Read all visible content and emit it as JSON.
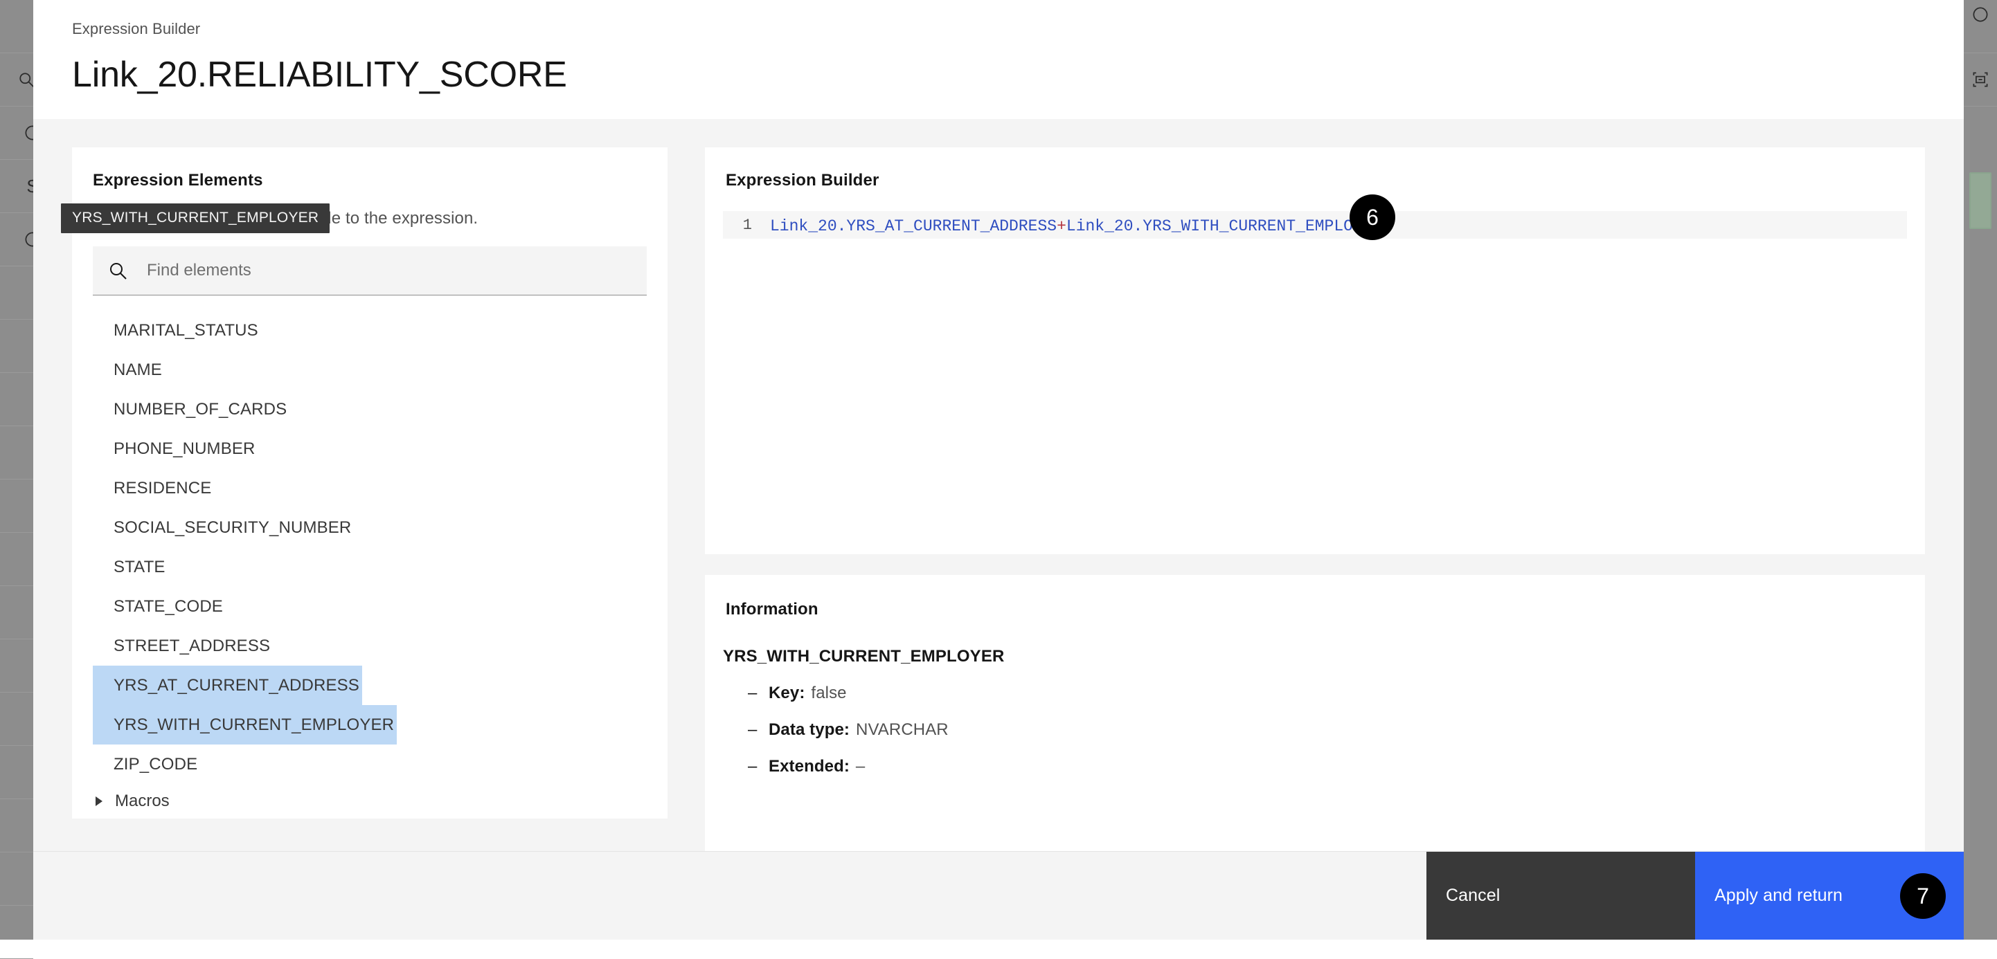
{
  "window": {
    "left_rail_icons": [
      "search-icon",
      "circle-icon",
      "s-icon",
      "circle-icon-2"
    ],
    "right_rail_icons": [
      "circle-icon",
      "component-icon"
    ]
  },
  "modal": {
    "eyebrow": "Expression Builder",
    "title": "Link_20.RELIABILITY_SCORE"
  },
  "tooltip": {
    "text": "YRS_WITH_CURRENT_EMPLOYER"
  },
  "left_panel": {
    "heading": "Expression Elements",
    "description": "Select an element to add its code to the expression.",
    "search": {
      "placeholder": "Find elements",
      "value": "",
      "icon": "search-icon"
    },
    "elements": [
      {
        "label": "MARITAL_STATUS",
        "selected": false
      },
      {
        "label": "NAME",
        "selected": false
      },
      {
        "label": "NUMBER_OF_CARDS",
        "selected": false
      },
      {
        "label": "PHONE_NUMBER",
        "selected": false
      },
      {
        "label": "RESIDENCE",
        "selected": false
      },
      {
        "label": "SOCIAL_SECURITY_NUMBER",
        "selected": false
      },
      {
        "label": "STATE",
        "selected": false
      },
      {
        "label": "STATE_CODE",
        "selected": false
      },
      {
        "label": "STREET_ADDRESS",
        "selected": false
      },
      {
        "label": "YRS_AT_CURRENT_ADDRESS",
        "selected": true
      },
      {
        "label": "YRS_WITH_CURRENT_EMPLOYER",
        "selected": true
      },
      {
        "label": "ZIP_CODE",
        "selected": false
      }
    ],
    "macros": {
      "label": "Macros",
      "expanded": false,
      "icon": "triangle-right-icon"
    },
    "selection_color": "#bcd8f5"
  },
  "expression_panel": {
    "heading": "Expression Builder",
    "line_number": "1",
    "code_part1": "Link_20.YRS_AT_CURRENT_ADDRESS",
    "code_operator": "+",
    "code_part2": "Link_20.YRS_WITH_CURRENT_EMPLOYER",
    "code_full": "Link_20.YRS_AT_CURRENT_ADDRESS+Link_20.YRS_WITH_CURRENT_EMPLOYER",
    "code_color": "#2f4ec0",
    "operator_color": "#b3343f"
  },
  "information_panel": {
    "heading": "Information",
    "element_name": "YRS_WITH_CURRENT_EMPLOYER",
    "rows": [
      {
        "dash": "–",
        "key": "Key:",
        "value": "false"
      },
      {
        "dash": "–",
        "key": "Data type:",
        "value": "NVARCHAR"
      },
      {
        "dash": "–",
        "key": "Extended:",
        "value": "–"
      }
    ]
  },
  "footer": {
    "cancel_label": "Cancel",
    "apply_label": "Apply and return",
    "primary_color": "#2f62f5",
    "cancel_color": "#393939"
  },
  "step_badges": [
    {
      "number": "6"
    },
    {
      "number": "7"
    }
  ]
}
